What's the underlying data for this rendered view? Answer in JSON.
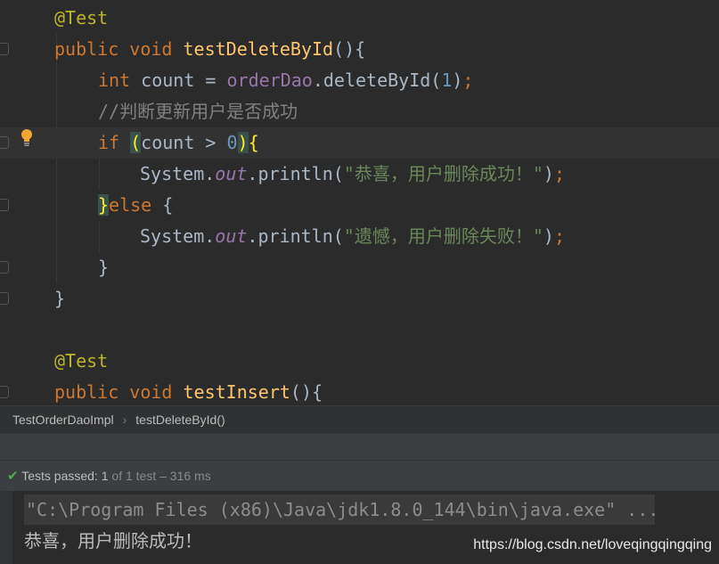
{
  "editor": {
    "lines": [
      {
        "annotation": "@Test"
      },
      {
        "kw": "public void ",
        "method": "testDeleteById",
        "rest": "(){"
      },
      {
        "kw": "int ",
        "a": "count = ",
        "field": "orderDao",
        "b": ".deleteById(",
        "num": "1",
        "c": ")",
        ";": ";"
      },
      {
        "comment": "//判断更新用户是否成功"
      },
      {
        "kw": "if ",
        "open": "(",
        "a": "count > ",
        "num": "0",
        "close": ")",
        "brace": "{"
      },
      {
        "a": "System.",
        "static": "out",
        "b": ".println(",
        "str": "\"恭喜，用户删除成功！\"",
        "c": ")",
        ";": ";"
      },
      {
        "brace": "}",
        "kw": "else ",
        "a": "{"
      },
      {
        "a": "System.",
        "static": "out",
        "b": ".println(",
        "str": "\"遗憾，用户删除失败！\"",
        "c": ")",
        ";": ";"
      },
      {
        "a": "}"
      },
      {
        "a": "}"
      },
      {
        "a": ""
      },
      {
        "annotation": "@Test"
      },
      {
        "kw": "public void ",
        "method": "testInsert",
        "rest": "(){"
      }
    ],
    "intention_icon": "lightbulb-icon"
  },
  "breadcrumb": {
    "items": [
      "TestOrderDaoImpl",
      "testDeleteById()"
    ],
    "separator": "›"
  },
  "status": {
    "icon": "check-icon",
    "label": "Tests passed: ",
    "count": "1",
    "of": " of 1 test",
    "time": " – 316 ms"
  },
  "console": {
    "command": "\"C:\\Program Files (x86)\\Java\\jdk1.8.0_144\\bin\\java.exe\" ...",
    "output": "恭喜，用户删除成功！"
  },
  "watermark": "https://blog.csdn.net/loveqingqingqing",
  "colors": {
    "background": "#2b2b2b",
    "keyword": "#cc7832",
    "method": "#ffc66d",
    "string": "#6a8759",
    "success": "#4caf50"
  }
}
